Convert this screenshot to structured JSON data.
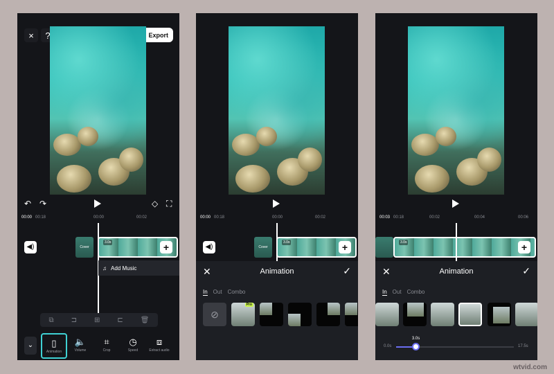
{
  "screen1": {
    "close_icon": "×",
    "help_icon": "?",
    "export_label": "Export",
    "time_current": "00:00",
    "time_total": "00:18",
    "ruler_marks": [
      "00:00",
      "00:02"
    ],
    "cover_label": "Cover",
    "clip_duration": "3.0s",
    "add_music_label": "Add Music",
    "toolbar": [
      {
        "label": "Animation",
        "icon": "animation-icon"
      },
      {
        "label": "Volume",
        "icon": "volume-icon"
      },
      {
        "label": "Crop",
        "icon": "crop-icon"
      },
      {
        "label": "Speed",
        "icon": "speed-icon"
      },
      {
        "label": "Extract audio",
        "icon": "extract-audio-icon"
      }
    ]
  },
  "screen2": {
    "time_current": "00:00",
    "time_total": "00:18",
    "ruler_marks": [
      "00:00",
      "00:02"
    ],
    "cover_label": "Cover",
    "clip_duration": "3.0s",
    "panel_title": "Animation",
    "tabs": [
      "In",
      "Out",
      "Combo"
    ],
    "pro_badge": "Pro"
  },
  "screen3": {
    "time_current": "00:03",
    "time_total": "00:18",
    "ruler_marks": [
      "00:02",
      "00:04",
      "00:06"
    ],
    "clip_duration": "3.0s",
    "panel_title": "Animation",
    "tabs": [
      "In",
      "Out",
      "Combo"
    ],
    "slider_min": "0.0s",
    "slider_max": "17.5s",
    "slider_value": "3.0s",
    "slider_fraction": 0.17
  },
  "watermark": "wtvid.com",
  "colors": {
    "background": "#bdb2b0",
    "phone_bg": "#141519",
    "accent_cyan": "#3fd1d4",
    "slider_purple": "#6b6ef2",
    "pro_green": "#c8f24a"
  }
}
